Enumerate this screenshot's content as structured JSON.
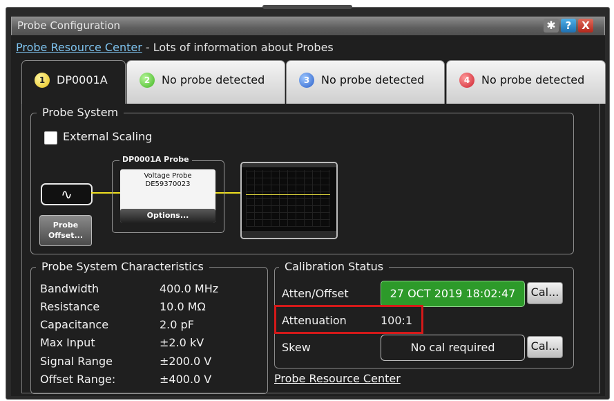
{
  "window": {
    "title": "Probe Configuration"
  },
  "titlebar": {
    "gear_icon": "gear-icon",
    "help_label": "?",
    "close_label": "X"
  },
  "resource": {
    "link": "Probe Resource Center",
    "text": "- Lots of information about Probes"
  },
  "tabs": [
    {
      "num": "1",
      "label": "DP0001A",
      "color": "#e7c21b",
      "active": true
    },
    {
      "num": "2",
      "label": "No probe detected",
      "color": "#3fb51f",
      "active": false
    },
    {
      "num": "3",
      "label": "No probe detected",
      "color": "#2a5fc8",
      "active": false
    },
    {
      "num": "4",
      "label": "No probe detected",
      "color": "#cc1e2c",
      "active": false
    }
  ],
  "probe_system": {
    "legend": "Probe System",
    "external_scaling": "External Scaling",
    "signal_icon": "sine-wave-icon",
    "probe_caption": "DP0001A Probe",
    "probe_type": "Voltage Probe",
    "probe_serial": "DE59370023",
    "options_btn": "Options...",
    "offset_btn_line1": "Probe",
    "offset_btn_line2": "Offset..."
  },
  "characteristics": {
    "legend": "Probe System Characteristics",
    "rows": [
      {
        "label": "Bandwidth",
        "value": "400.0 MHz"
      },
      {
        "label": "Resistance",
        "value": "10.0 MΩ"
      },
      {
        "label": "Capacitance",
        "value": "2.0 pF"
      },
      {
        "label": "Max Input",
        "value": "±2.0 kV"
      },
      {
        "label": "Signal Range",
        "value": "±200.0 V"
      },
      {
        "label": "Offset Range:",
        "value": "±400.0 V"
      }
    ]
  },
  "calibration": {
    "legend": "Calibration Status",
    "atten_offset_label": "Atten/Offset",
    "atten_offset_value": "27 OCT 2019 18:02:47",
    "cal_btn": "Cal...",
    "attenuation_label": "Attenuation",
    "attenuation_value": "100:1",
    "skew_label": "Skew",
    "skew_value": "No cal required",
    "skew_cal_btn": "Cal...",
    "link": "Probe Resource Center"
  }
}
